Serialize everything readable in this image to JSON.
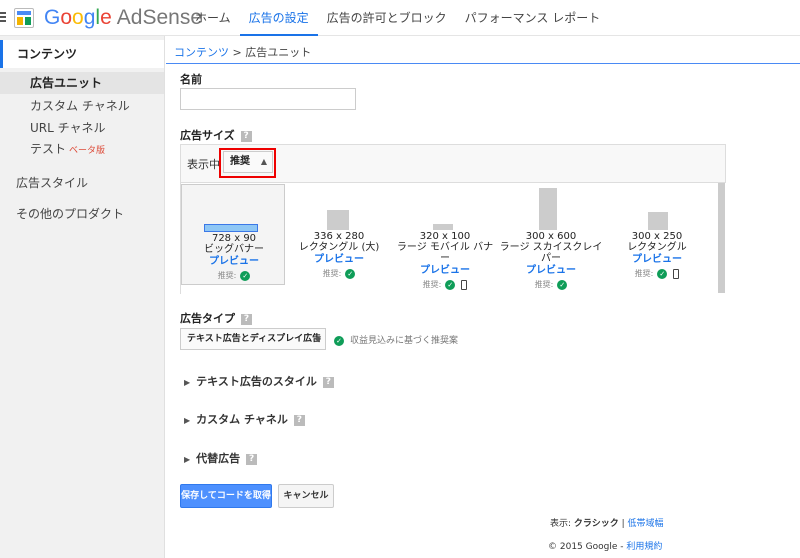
{
  "header": {
    "logo_google": [
      "G",
      "o",
      "o",
      "g",
      "l",
      "e"
    ],
    "logo_product": "AdSense",
    "nav": [
      {
        "label": "ホーム",
        "active": false
      },
      {
        "label": "広告の設定",
        "active": true
      },
      {
        "label": "広告の許可とブロック",
        "active": false
      },
      {
        "label": "パフォーマンス レポート",
        "active": false
      }
    ]
  },
  "sidebar": {
    "section": "コンテンツ",
    "items": [
      {
        "label": "広告ユニット",
        "active": true
      },
      {
        "label": "カスタム チャネル"
      },
      {
        "label": "URL チャネル"
      },
      {
        "label": "テスト"
      }
    ],
    "beta_label": "ベータ版",
    "others": [
      "広告スタイル",
      "その他のプロダクト"
    ]
  },
  "breadcrumb": {
    "link": "コンテンツ",
    "separator": " > ",
    "current": "広告ユニット"
  },
  "form": {
    "name_label": "名前",
    "name_value": "",
    "size_label": "広告サイズ",
    "help_glyph": "?",
    "showing_label": "表示中",
    "filter_value": "推奨",
    "cards": [
      {
        "dims": "728 x 90",
        "name": "ビッグバナー",
        "preview": "プレビュー",
        "rec": "推奨:",
        "selected": true,
        "mobile": false
      },
      {
        "dims": "336 x 280",
        "name": "レクタングル (大)",
        "preview": "プレビュー",
        "rec": "推奨:",
        "selected": false,
        "mobile": false
      },
      {
        "dims": "320 x 100",
        "name": "ラージ モバイル バナー",
        "preview": "プレビュー",
        "rec": "推奨:",
        "selected": false,
        "mobile": true
      },
      {
        "dims": "300 x 600",
        "name": "ラージ スカイスクレイパー",
        "preview": "プレビュー",
        "rec": "推奨:",
        "selected": false,
        "mobile": false
      },
      {
        "dims": "300 x 250",
        "name": "レクタングル",
        "preview": "プレビュー",
        "rec": "推奨:",
        "selected": false,
        "mobile": true
      }
    ],
    "type_label": "広告タイプ",
    "type_value": "テキスト広告とディスプレイ広告",
    "type_note": "収益見込みに基づく推奨案",
    "sections": [
      "テキスト広告のスタイル",
      "カスタム チャネル",
      "代替広告"
    ],
    "save_label": "保存してコードを取得",
    "cancel_label": "キャンセル"
  },
  "footer": {
    "display_label": "表示:",
    "display_mode": "クラシック",
    "sep": "|",
    "bandwidth_link": "低帯域幅",
    "copyright": "© 2015 Google -",
    "terms_link": "利用規約"
  },
  "colors": {
    "accent": "#1a73e8",
    "primary_button": "#4d90fe",
    "highlight_frame": "#ee0000",
    "check": "#0f9d58"
  }
}
